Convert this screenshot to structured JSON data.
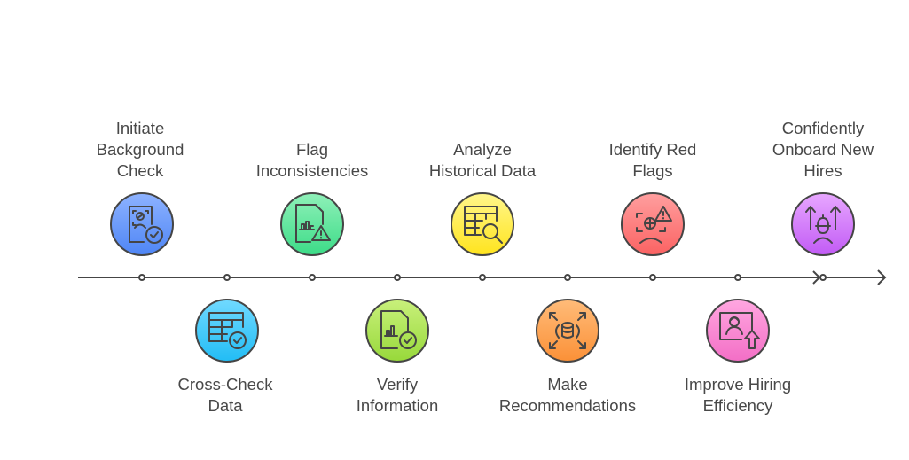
{
  "diagram": {
    "type": "timeline",
    "steps": [
      {
        "label": "Initiate\nBackground\nCheck",
        "position": "top",
        "icon": "id-verify-check-icon",
        "color_top": "#8db2ff",
        "color_bottom": "#4f86f5"
      },
      {
        "label": "Cross-Check\nData",
        "position": "bottom",
        "icon": "table-check-icon",
        "color_top": "#6fd9ff",
        "color_bottom": "#23bdf5"
      },
      {
        "label": "Flag\nInconsistencies",
        "position": "top",
        "icon": "document-chart-warning-icon",
        "color_top": "#8ef0b8",
        "color_bottom": "#3ddc88"
      },
      {
        "label": "Verify\nInformation",
        "position": "bottom",
        "icon": "document-chart-check-icon",
        "color_top": "#c8f07a",
        "color_bottom": "#98d93b"
      },
      {
        "label": "Analyze\nHistorical Data",
        "position": "top",
        "icon": "table-search-icon",
        "color_top": "#fff68a",
        "color_bottom": "#ffe41f"
      },
      {
        "label": "Make\nRecommendations",
        "position": "bottom",
        "icon": "database-expand-icon",
        "color_top": "#ffbb78",
        "color_bottom": "#fb9138"
      },
      {
        "label": "Identify Red\nFlags",
        "position": "top",
        "icon": "face-scan-warning-icon",
        "color_top": "#ff9e9e",
        "color_bottom": "#fb6363"
      },
      {
        "label": "Improve Hiring\nEfficiency",
        "position": "bottom",
        "icon": "profile-upgrade-icon",
        "color_top": "#ffa6e0",
        "color_bottom": "#f36fc6"
      },
      {
        "label": "Confidently\nOnboard New\nHires",
        "position": "top",
        "icon": "worker-growth-icon",
        "color_top": "#e7a6ff",
        "color_bottom": "#c25cf5"
      }
    ],
    "line_color": "#454545",
    "text_color": "#484848"
  }
}
